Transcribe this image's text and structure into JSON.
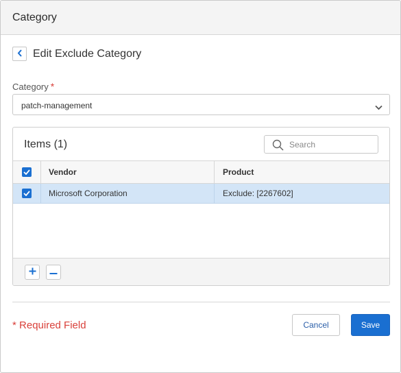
{
  "header": {
    "title": "Category"
  },
  "editor": {
    "title": "Edit Exclude Category"
  },
  "category_field": {
    "label": "Category",
    "required_mark": "*",
    "selected_value": "patch-management"
  },
  "items_panel": {
    "title": "Items (1)",
    "search": {
      "placeholder": "Search",
      "value": ""
    },
    "columns": {
      "vendor": "Vendor",
      "product": "Product"
    },
    "rows": [
      {
        "checked": true,
        "selected": true,
        "vendor": "Microsoft Corporation",
        "product": "Exclude: [2267602]"
      }
    ],
    "header_checkbox_checked": true
  },
  "footer": {
    "required_note_mark": "*",
    "required_note": "Required Field",
    "cancel_label": "Cancel",
    "save_label": "Save"
  },
  "colors": {
    "accent": "#1a6fd1",
    "selected_row": "#d3e5f7",
    "required": "#d9403a"
  },
  "icons": [
    "chevron-left-icon",
    "chevron-down-icon",
    "search-icon",
    "checkmark-icon",
    "plus-icon",
    "minus-icon"
  ]
}
